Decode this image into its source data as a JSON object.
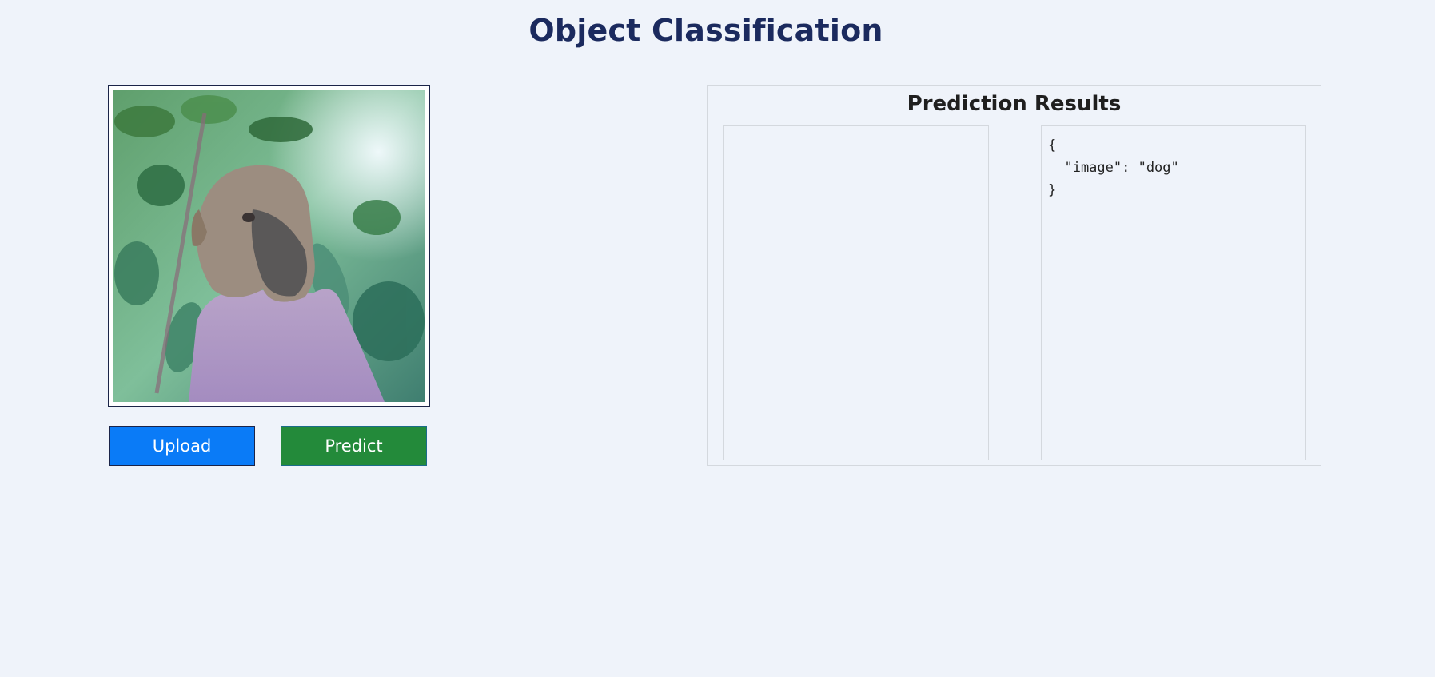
{
  "page": {
    "title": "Object Classification"
  },
  "preview": {
    "alt": "dog photo"
  },
  "buttons": {
    "upload": "Upload",
    "predict": "Predict"
  },
  "results": {
    "title": "Prediction Results",
    "json_text": "{\n  \"image\": \"dog\"\n}"
  },
  "colors": {
    "background": "#eff3fa",
    "title": "#1b2a5e",
    "upload_button": "#0a7bf7",
    "predict_button": "#238a3a"
  }
}
